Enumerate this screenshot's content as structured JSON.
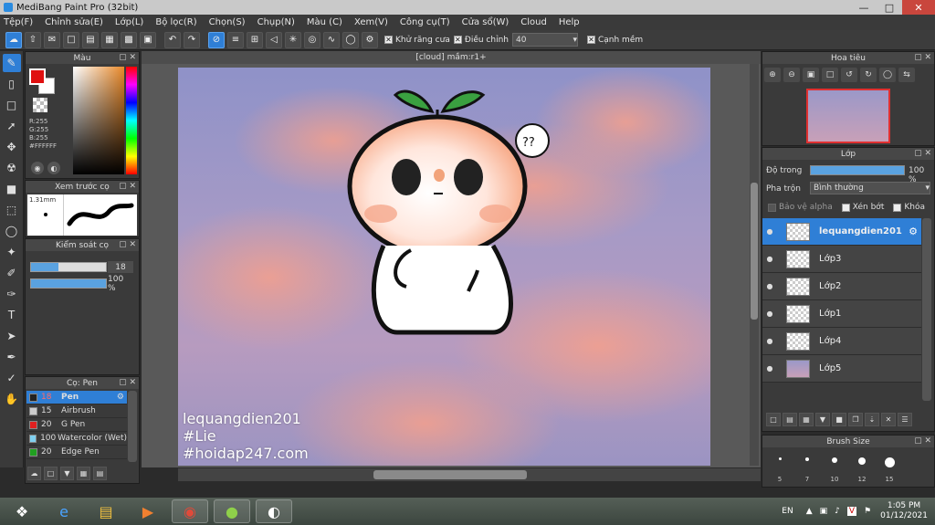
{
  "window": {
    "title": "MediBang Paint Pro (32bit)"
  },
  "menu": [
    "Tệp(F)",
    "Chỉnh sửa(E)",
    "Lớp(L)",
    "Bộ lọc(R)",
    "Chọn(S)",
    "Chụp(N)",
    "Màu (C)",
    "Xem(V)",
    "Công cụ(T)",
    "Cửa sổ(W)",
    "Cloud",
    "Help"
  ],
  "toolbar": {
    "antialias_label": "Khử răng cưa",
    "correction_label": "Điều chỉnh",
    "correction_value": "40",
    "edge_label": "Cạnh mềm"
  },
  "color_panel": {
    "title": "Màu",
    "r": "R:255",
    "g": "G:255",
    "b": "B:255",
    "hex": "#FFFFFF",
    "fg": "#e01010",
    "bg": "#ffffff"
  },
  "preview_panel": {
    "title": "Xem trước cọ",
    "size": "1.31mm"
  },
  "control_panel": {
    "title": "Kiểm soát cọ",
    "size_value": "18",
    "opacity_value": "100 %",
    "size_fraction": 0.36,
    "opacity_fraction": 1.0
  },
  "brush_panel": {
    "title": "Cọ: Pen",
    "brushes": [
      {
        "size": "18",
        "name": "Pen",
        "color": "#222222"
      },
      {
        "size": "15",
        "name": "Airbrush",
        "color": "#cccccc"
      },
      {
        "size": "20",
        "name": "G Pen",
        "color": "#e02020"
      },
      {
        "size": "100",
        "name": "Watercolor (Wet)",
        "color": "#7fd0f0"
      },
      {
        "size": "20",
        "name": "Edge Pen",
        "color": "#20a020"
      }
    ]
  },
  "document": {
    "tab": "[cloud] mầm:r1+",
    "caption": [
      "lequangdien201",
      "#Lie",
      "#hoidap247.com"
    ]
  },
  "nav_panel": {
    "title": "Hoa tiêu"
  },
  "layer_panel": {
    "title": "Lớp",
    "opacity_label": "Độ trong",
    "opacity_value": "100 %",
    "blend_label": "Pha trộn",
    "blend_value": "Bình thường",
    "protect_alpha": "Bảo vệ alpha",
    "clipping": "Xén bớt",
    "lock": "Khóa",
    "layers": [
      {
        "name": "lequangdien201",
        "selected": true
      },
      {
        "name": "Lớp3",
        "selected": false
      },
      {
        "name": "Lớp2",
        "selected": false
      },
      {
        "name": "Lớp1",
        "selected": false
      },
      {
        "name": "Lớp4",
        "selected": false
      },
      {
        "name": "Lớp5",
        "selected": false
      }
    ]
  },
  "brush_size_panel": {
    "title": "Brush Size",
    "sizes": [
      "5",
      "7",
      "10",
      "12",
      "15"
    ]
  },
  "taskbar": {
    "lang": "EN",
    "time": "1:05 PM",
    "date": "01/12/2021"
  }
}
